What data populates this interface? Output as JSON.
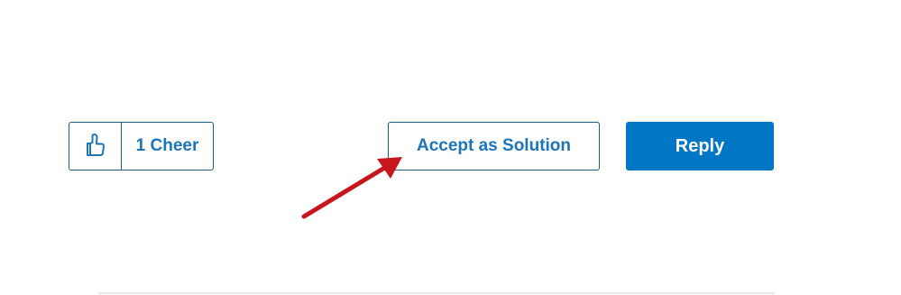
{
  "actions": {
    "cheer_count_label": "1 Cheer",
    "accept_label": "Accept as Solution",
    "reply_label": "Reply"
  },
  "icons": {
    "cheer": "thumbs-up-icon",
    "annotation": "red-arrow-annotation"
  },
  "colors": {
    "accent": "#0077c5",
    "text_link": "#1b75b8",
    "border": "#1b5d87",
    "annotation": "#c8161d"
  }
}
